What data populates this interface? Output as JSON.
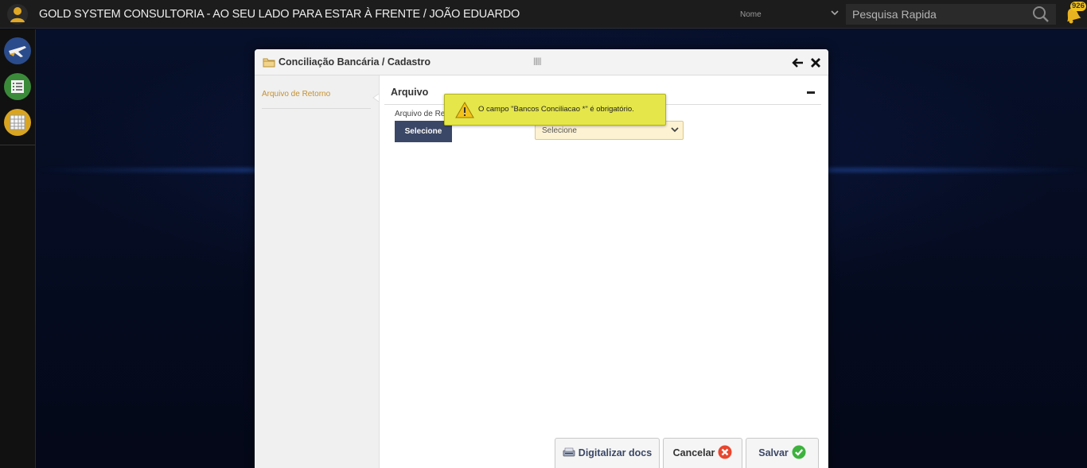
{
  "header": {
    "app_title": "GOLD SYSTEM CONSULTORIA - AO SEU LADO PARA ESTAR À FRENTE / JOÃO EDUARDO",
    "search_field_select": "Nome",
    "search_placeholder": "Pesquisa Rapida",
    "notification_count": "926"
  },
  "sidebar": {
    "items": [
      {
        "icon": "plane-icon",
        "color": "#2a4c8c"
      },
      {
        "icon": "list-icon",
        "color": "#3a8a3a"
      },
      {
        "icon": "grid-icon",
        "color": "#d9a520"
      }
    ]
  },
  "modal": {
    "title": "Conciliação Bancária / Cadastro",
    "left_nav": {
      "items": [
        {
          "label": "Arquivo de Retorno"
        }
      ]
    },
    "panel": {
      "title": "Arquivo",
      "field_label": "Arquivo de Retorno",
      "select_button_label": "Selecione",
      "bank_select_value": "Selecione"
    },
    "tooltip": {
      "message": "O campo \"Bancos Conciliacao *\" é obrigatório."
    },
    "footer": {
      "digitalizar_label": "Digitalizar docs",
      "cancelar_label": "Cancelar",
      "salvar_label": "Salvar"
    }
  },
  "colors": {
    "accent_gold": "#c39030",
    "button_navy": "#3b4766",
    "tooltip_yellow": "#e4e64a",
    "cancel_red": "#e8462f",
    "save_green": "#3db33d"
  }
}
